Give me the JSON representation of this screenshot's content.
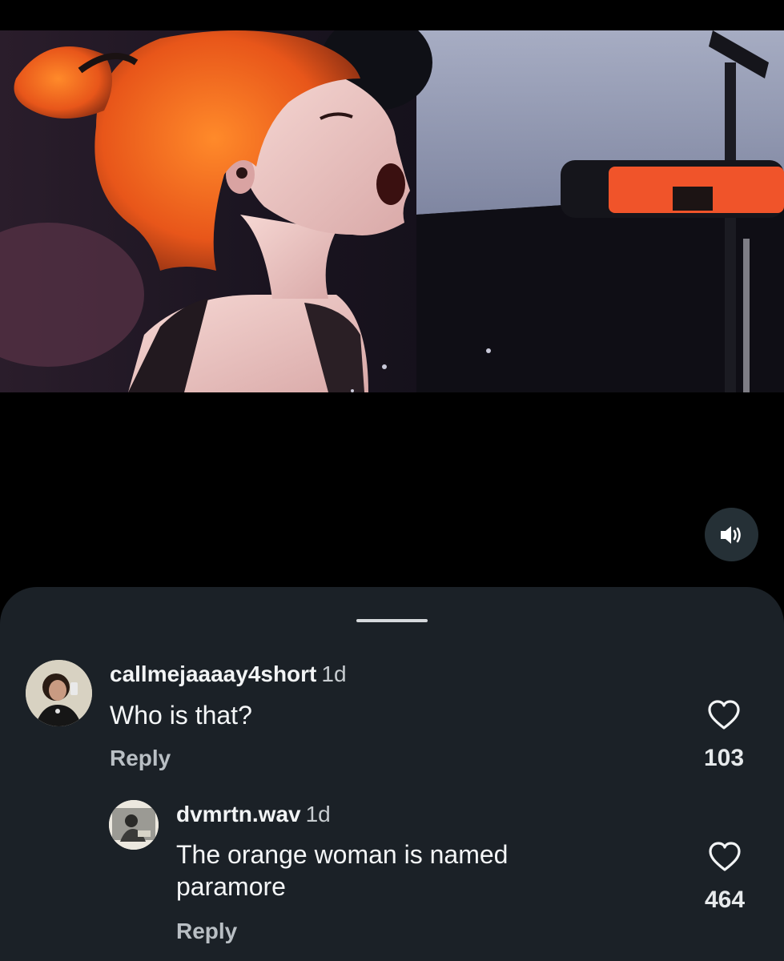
{
  "video": {
    "sound_icon": "speaker-volume-icon"
  },
  "sheet": {
    "handle_icon": "drag-handle"
  },
  "comments": [
    {
      "username": "callmejaaaay4short",
      "time": "1d",
      "text": "Who is that?",
      "reply_label": "Reply",
      "like_count": "103",
      "like_icon": "heart-outline-icon"
    },
    {
      "username": "dvmrtn.wav",
      "time": "1d",
      "text_line1": "The orange woman is named",
      "text_line2": "paramore",
      "reply_label": "Reply",
      "like_count": "464",
      "like_icon": "heart-outline-icon"
    }
  ],
  "colors": {
    "background": "#000000",
    "sheet": "#1b2127",
    "sound_button": "#253036",
    "text_primary": "#f2f4f5",
    "text_secondary": "#b9bfc4"
  }
}
